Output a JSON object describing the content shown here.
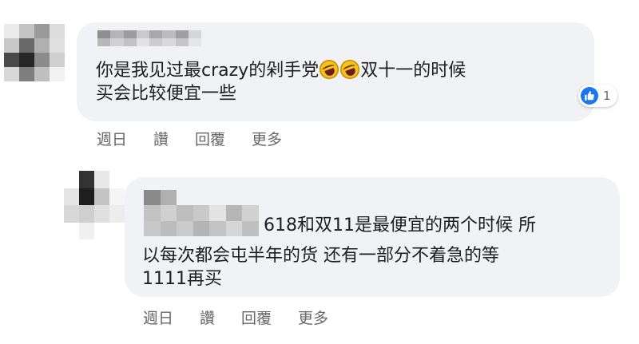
{
  "comments": [
    {
      "text_before_emoji": "你是我见过最crazy的剁手党",
      "emojis": [
        "rolling-on-floor-laughing-emoji",
        "rolling-on-floor-laughing-emoji"
      ],
      "text_after_emoji": "双十一的时候",
      "text_line2": "买会比较便宜一些",
      "reactions": {
        "icon": "thumbs-up-icon",
        "count": "1",
        "color": "#1877f2"
      },
      "actions": [
        "週日",
        "讚",
        "回覆",
        "更多"
      ]
    },
    {
      "text_line1": "618和双11是最便宜的两个时候 所",
      "text_line2": "以每次都会屯半年的货 还有一部分不着急的等",
      "text_line3": "1111再买",
      "actions": [
        "週日",
        "讚",
        "回覆",
        "更多"
      ]
    }
  ],
  "colors": {
    "bubble": "#f0f2f5",
    "text": "#1c1e21",
    "secondary_text": "#65676b"
  }
}
